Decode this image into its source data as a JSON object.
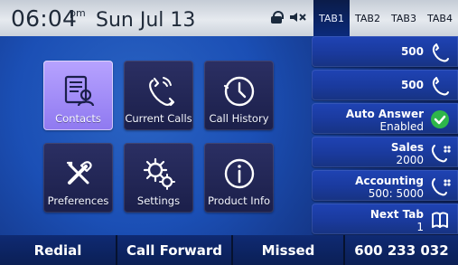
{
  "status_bar": {
    "time": "06:04",
    "ampm": "pm",
    "date": "Sun Jul 13",
    "icons": [
      "lock-icon",
      "mute-icon"
    ],
    "tabs": [
      {
        "label": "TAB1",
        "active": true
      },
      {
        "label": "TAB2",
        "active": false
      },
      {
        "label": "TAB3",
        "active": false
      },
      {
        "label": "TAB4",
        "active": false
      }
    ]
  },
  "menu": {
    "tiles": [
      {
        "label": "Contacts",
        "icon": "contacts-icon",
        "selected": true
      },
      {
        "label": "Current Calls",
        "icon": "current-calls-icon",
        "selected": false
      },
      {
        "label": "Call History",
        "icon": "call-history-icon",
        "selected": false
      },
      {
        "label": "Preferences",
        "icon": "preferences-icon",
        "selected": false
      },
      {
        "label": "Settings",
        "icon": "settings-icon",
        "selected": false
      },
      {
        "label": "Product Info",
        "icon": "info-icon",
        "selected": false
      }
    ]
  },
  "lines": [
    {
      "line1": "500",
      "line2": "",
      "icon": "phone-icon"
    },
    {
      "line1": "500",
      "line2": "",
      "icon": "phone-icon"
    },
    {
      "line1": "Auto Answer",
      "line2": "Enabled",
      "icon": "check-icon"
    },
    {
      "line1": "Sales",
      "line2": "2000",
      "icon": "phone-dots-icon"
    },
    {
      "line1": "Accounting",
      "line2": "500: 5000",
      "icon": "phone-dots-icon"
    },
    {
      "line1": "Next Tab",
      "line2": "1",
      "icon": "book-icon"
    }
  ],
  "softkeys": [
    {
      "label": "Redial"
    },
    {
      "label": "Call Forward"
    },
    {
      "label": "Missed"
    },
    {
      "label": "600 233 032"
    }
  ],
  "colors": {
    "background": "#1b4fb5",
    "tile": "#1b1f4a",
    "tile_selected": "#9b86f6",
    "line_panel": "#1a3a9d",
    "softkey": "#0b1f55",
    "status_bar": "#dfe4ea",
    "accent_check": "#2eb64a"
  }
}
